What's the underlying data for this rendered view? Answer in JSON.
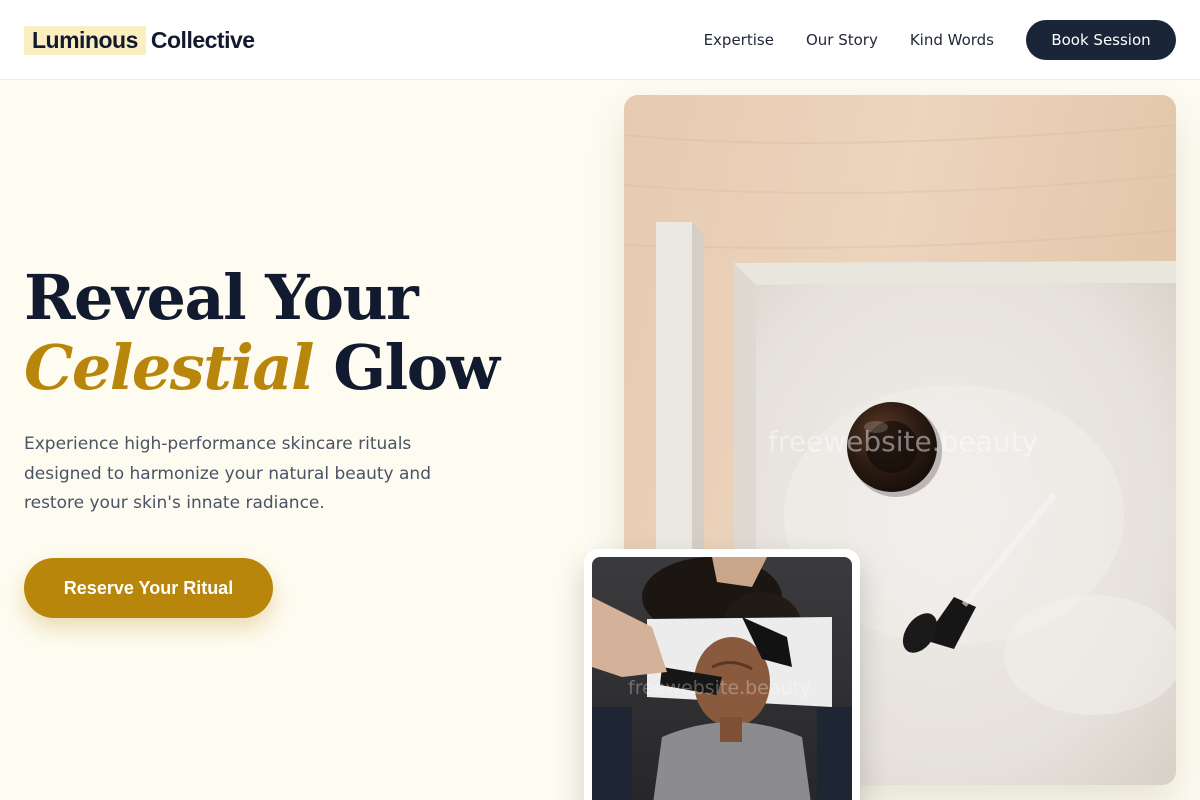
{
  "brand": {
    "logo_highlight": "Luminous",
    "logo_rest": "Collective",
    "highlight_color": "#fbeec1"
  },
  "nav": {
    "links": [
      "Expertise",
      "Our Story",
      "Kind Words"
    ],
    "cta_label": "Book Session"
  },
  "hero": {
    "title_line1": "Reveal Your",
    "title_accent": "Celestial",
    "title_rest": "Glow",
    "subtitle": "Experience high-performance skincare rituals designed to harmonize your natural beauty and restore your skin's innate radiance.",
    "cta_label": "Reserve Your Ritual"
  },
  "images": {
    "main_watermark": "freewebsite.beauty",
    "secondary_watermark": "freewebsite.beauty",
    "main_icon": "serum-bottle-and-dropper-photo",
    "secondary_icon": "facial-treatment-photo"
  },
  "colors": {
    "accent_gold": "#b8860b",
    "navy": "#1b2538",
    "page_background": "#fefcf1"
  }
}
